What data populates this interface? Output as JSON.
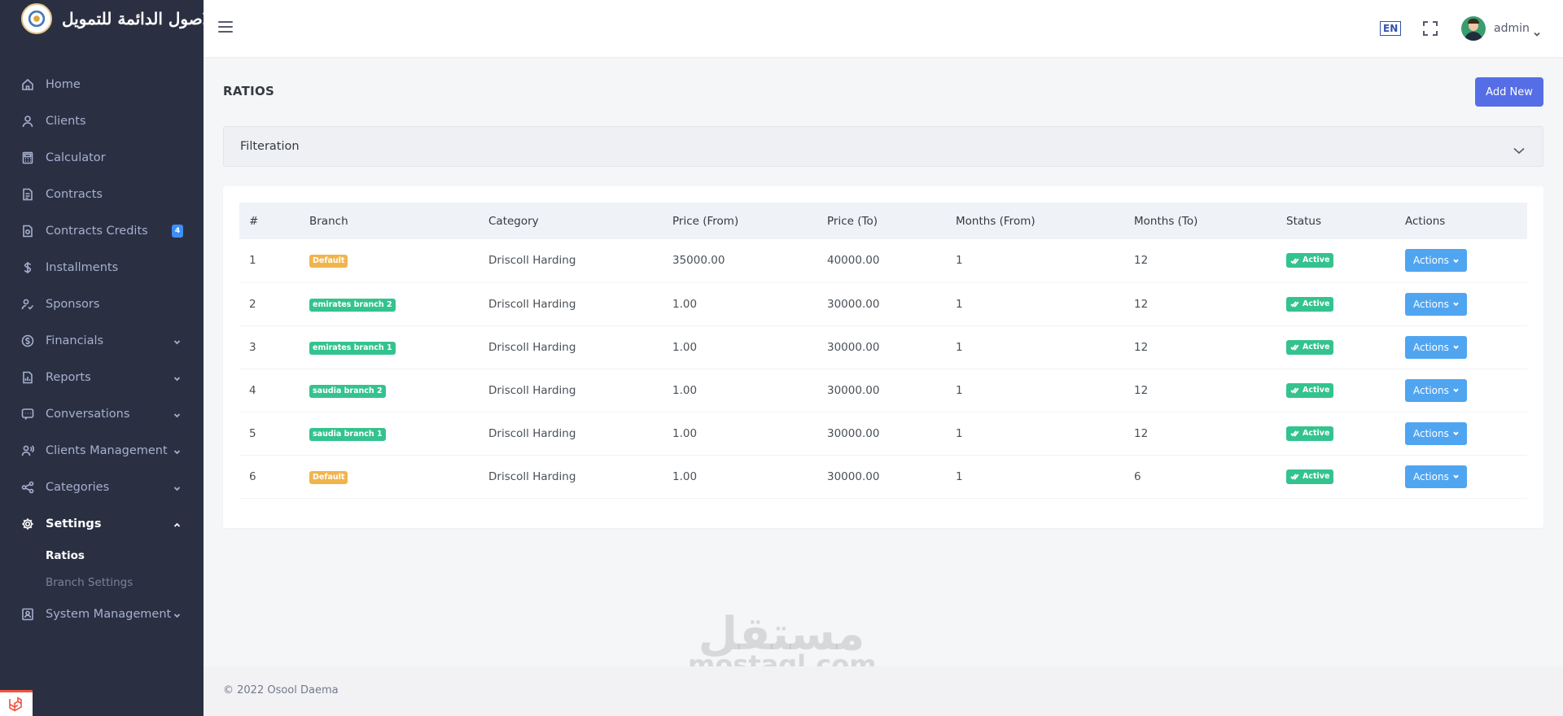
{
  "brand": {
    "name": "الاصول الدائمة للتمويل"
  },
  "sidebar": {
    "items": [
      {
        "label": "Home",
        "icon": "home-icon"
      },
      {
        "label": "Clients",
        "icon": "user-icon"
      },
      {
        "label": "Calculator",
        "icon": "calculator-icon"
      },
      {
        "label": "Contracts",
        "icon": "document-icon"
      },
      {
        "label": "Contracts Credits",
        "icon": "document-credit-icon",
        "badge": "4"
      },
      {
        "label": "Installments",
        "icon": "dollar-icon"
      },
      {
        "label": "Sponsors",
        "icon": "user-check-icon"
      },
      {
        "label": "Financials",
        "icon": "coin-icon"
      },
      {
        "label": "Reports",
        "icon": "report-icon"
      },
      {
        "label": "Conversations",
        "icon": "chat-icon"
      },
      {
        "label": "Clients Management",
        "icon": "user-voice-icon"
      },
      {
        "label": "Categories",
        "icon": "share-icon"
      },
      {
        "label": "Settings",
        "icon": "gear-icon"
      },
      {
        "label": "System Management",
        "icon": "id-card-icon"
      }
    ],
    "settings_sub": [
      "Ratios",
      "Branch Settings"
    ]
  },
  "topbar": {
    "lang": "EN",
    "user_name": "admin"
  },
  "page": {
    "title": "RATIOS",
    "add_button": "Add New",
    "filter_label": "Filteration"
  },
  "table": {
    "headers": [
      "#",
      "Branch",
      "Category",
      "Price (From)",
      "Price (To)",
      "Months (From)",
      "Months (To)",
      "Status",
      "Actions"
    ],
    "rows": [
      {
        "id": "1",
        "branch": "Default",
        "category": "Driscoll Harding",
        "price_from": "35000.00",
        "price_to": "40000.00",
        "months_from": "1",
        "months_to": "12",
        "status": "Active",
        "action": "Actions"
      },
      {
        "id": "2",
        "branch": "emirates branch 2",
        "category": "Driscoll Harding",
        "price_from": "1.00",
        "price_to": "30000.00",
        "months_from": "1",
        "months_to": "12",
        "status": "Active",
        "action": "Actions"
      },
      {
        "id": "3",
        "branch": "emirates branch 1",
        "category": "Driscoll Harding",
        "price_from": "1.00",
        "price_to": "30000.00",
        "months_from": "1",
        "months_to": "12",
        "status": "Active",
        "action": "Actions"
      },
      {
        "id": "4",
        "branch": "saudia branch 2",
        "category": "Driscoll Harding",
        "price_from": "1.00",
        "price_to": "30000.00",
        "months_from": "1",
        "months_to": "12",
        "status": "Active",
        "action": "Actions"
      },
      {
        "id": "5",
        "branch": "saudia branch 1",
        "category": "Driscoll Harding",
        "price_from": "1.00",
        "price_to": "30000.00",
        "months_from": "1",
        "months_to": "12",
        "status": "Active",
        "action": "Actions"
      },
      {
        "id": "6",
        "branch": "Default",
        "category": "Driscoll Harding",
        "price_from": "1.00",
        "price_to": "30000.00",
        "months_from": "1",
        "months_to": "6",
        "status": "Active",
        "action": "Actions"
      }
    ]
  },
  "colors": {
    "sidebar_bg": "#2a3042",
    "primary": "#556ee6",
    "branch_default": "#f1b44c",
    "branch_other": "#34c38f",
    "status_active": "#34c38f",
    "actions_btn": "#50a5f1"
  },
  "footer": {
    "text": "© 2022 Osool Daema"
  },
  "watermark": {
    "arabic": "مستقل",
    "latin": "mostaql.com"
  }
}
